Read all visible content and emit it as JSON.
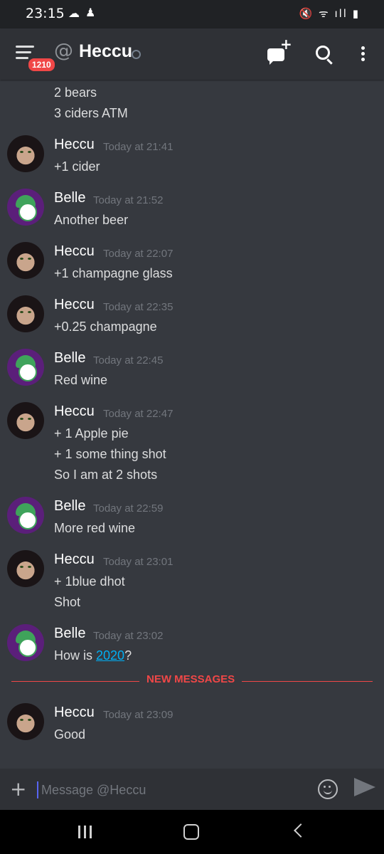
{
  "status_bar": {
    "time": "23:15",
    "cloud_icon": "cloud-icon",
    "app_icon": "notification-icon",
    "right_icons": "🔇 ᯤ ıll ▮"
  },
  "header": {
    "badge_count": "1210",
    "at_symbol": "@",
    "title": "Heccu"
  },
  "top_fragment": {
    "lines": [
      "2 bears",
      "3 ciders ATM"
    ]
  },
  "messages": [
    {
      "user": "Heccu",
      "time": "Today at 21:41",
      "lines": [
        "+1 cider"
      ]
    },
    {
      "user": "Belle",
      "time": "Today at 21:52",
      "lines": [
        "Another beer"
      ]
    },
    {
      "user": "Heccu",
      "time": "Today at 22:07",
      "lines": [
        "+1 champagne glass"
      ]
    },
    {
      "user": "Heccu",
      "time": "Today at 22:35",
      "lines": [
        "+0.25 champagne"
      ]
    },
    {
      "user": "Belle",
      "time": "Today at 22:45",
      "lines": [
        "Red wine"
      ]
    },
    {
      "user": "Heccu",
      "time": "Today at 22:47",
      "lines": [
        "+ 1 Apple pie",
        "+ 1 some thing shot",
        "So I am at 2 shots"
      ]
    },
    {
      "user": "Belle",
      "time": "Today at 22:59",
      "lines": [
        "More red wine"
      ]
    },
    {
      "user": "Heccu",
      "time": "Today at 23:01",
      "lines": [
        "+ 1blue dhot",
        "Shot"
      ]
    },
    {
      "user": "Belle",
      "time": "Today at 23:02",
      "lines": [
        "How is ",
        "2020",
        "?"
      ]
    },
    {
      "user": "Heccu",
      "time": "Today at 23:09",
      "lines": [
        "Good"
      ]
    }
  ],
  "divider": {
    "label": "NEW MESSAGES"
  },
  "composer": {
    "placeholder": "Message @Heccu",
    "plus": "+"
  }
}
